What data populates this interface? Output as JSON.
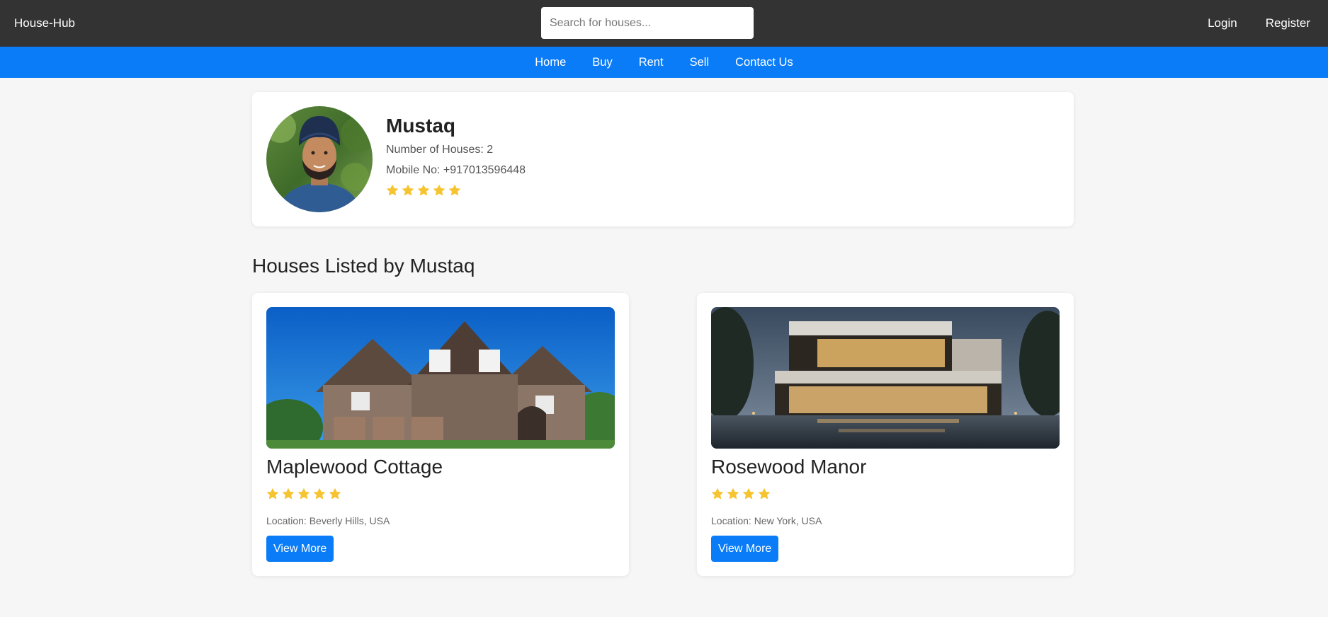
{
  "header": {
    "brand": "House-Hub",
    "search_placeholder": "Search for houses...",
    "login_label": "Login",
    "register_label": "Register"
  },
  "nav": {
    "items": [
      {
        "label": "Home"
      },
      {
        "label": "Buy"
      },
      {
        "label": "Rent"
      },
      {
        "label": "Sell"
      },
      {
        "label": "Contact Us"
      }
    ]
  },
  "owner": {
    "name": "Mustaq",
    "houses_text": "Number of Houses: 2",
    "mobile_text": "Mobile No: +917013596448",
    "rating": 5
  },
  "section": {
    "title": "Houses Listed by Mustaq"
  },
  "listings": [
    {
      "title": "Maplewood Cottage",
      "rating": 5,
      "location": "Location: Beverly Hills, USA",
      "button_label": "View More"
    },
    {
      "title": "Rosewood Manor",
      "rating": 4,
      "location": "Location: New York, USA",
      "button_label": "View More"
    }
  ],
  "colors": {
    "topbar": "#333333",
    "navbar": "#0a7cf8",
    "star": "#f7c431",
    "button": "#0a7cf8"
  },
  "icons": {
    "star": "star-icon"
  }
}
